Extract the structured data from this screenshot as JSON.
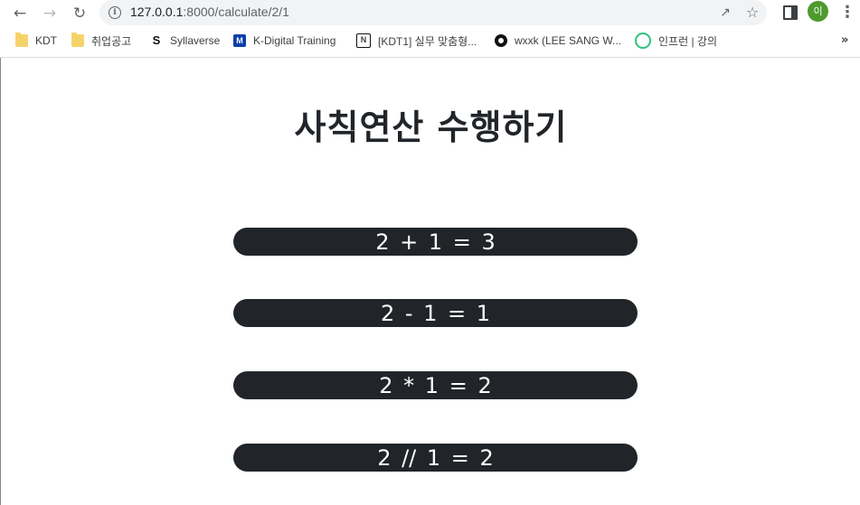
{
  "browser": {
    "url_host": "127.0.0.1",
    "url_path": ":8000/calculate/2/1",
    "avatar_initial": "이",
    "nav": {
      "back_icon": "back-arrow-icon",
      "forward_icon": "forward-arrow-icon",
      "reload_icon": "reload-icon"
    }
  },
  "bookmarks": [
    {
      "label": "KDT",
      "icon": "folder-icon"
    },
    {
      "label": "취업공고",
      "icon": "folder-icon"
    },
    {
      "label": "Syllaverse",
      "icon": "syllaverse-icon"
    },
    {
      "label": "K-Digital Training",
      "icon": "k-digital-icon"
    },
    {
      "label": "[KDT1] 실무 맞춤형...",
      "icon": "notion-icon"
    },
    {
      "label": "wxxk (LEE SANG W...",
      "icon": "github-icon"
    },
    {
      "label": "인프런 | 강의",
      "icon": "inflearn-icon"
    }
  ],
  "page": {
    "title": "사칙연산 수행하기",
    "results": [
      "2 + 1 = 3",
      "2 - 1 = 1",
      "2 * 1 = 2",
      "2 // 1 = 2"
    ]
  },
  "colors": {
    "result_background": "#212529",
    "result_text": "#ffffff",
    "title_text": "#212529"
  }
}
